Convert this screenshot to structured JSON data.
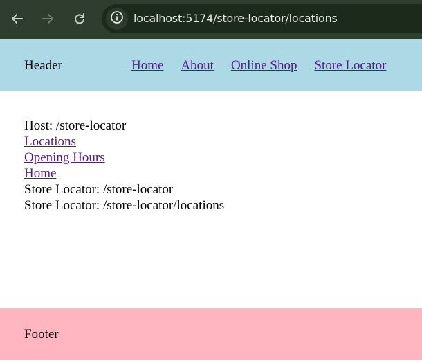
{
  "browser": {
    "url": "localhost:5174/store-locator/locations",
    "icons": {
      "back": "arrow-left-icon",
      "forward": "arrow-right-icon",
      "reload": "reload-icon",
      "site_info": "info-icon"
    }
  },
  "header": {
    "title": "Header",
    "nav": [
      {
        "label": "Home"
      },
      {
        "label": "About"
      },
      {
        "label": "Online Shop"
      },
      {
        "label": "Store Locator"
      }
    ]
  },
  "main": {
    "host_text": "Host: /store-locator",
    "links": [
      {
        "label": "Locations"
      },
      {
        "label": "Opening Hours"
      },
      {
        "label": "Home"
      }
    ],
    "lines": [
      "Store Locator: /store-locator",
      "Store Locator: /store-locator/locations"
    ]
  },
  "footer": {
    "text": "Footer"
  },
  "colors": {
    "header_bg": "#add8e6",
    "footer_bg": "#ffb6c1",
    "link": "#551a8b",
    "browser_chrome": "#2f3d2f"
  }
}
